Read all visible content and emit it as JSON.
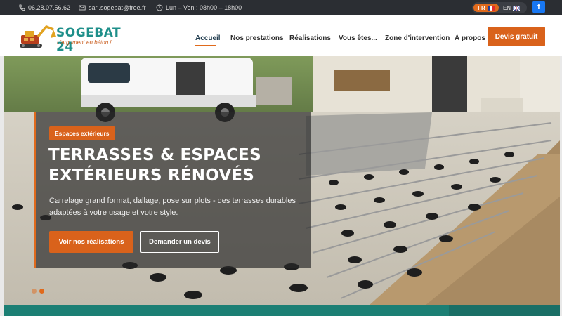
{
  "topbar": {
    "phone": "06.28.07.56.62",
    "email": "sarl.sogebat@free.fr",
    "hours": "Lun – Ven : 08h00 – 18h00",
    "lang_fr": "FR",
    "lang_en": "EN",
    "facebook": "f"
  },
  "header": {
    "logo_name": "SOGEBAT 24",
    "logo_tagline": "L'argument en béton !",
    "nav": [
      "Accueil",
      "Nos prestations",
      "Réalisations",
      "Vous êtes...",
      "Zone d'intervention",
      "À propos"
    ],
    "cta": "Devis gratuit"
  },
  "hero": {
    "badge": "Espaces extérieurs",
    "title_line1": "TERRASSES & ESPACES",
    "title_line2": "EXTÉRIEURS RÉNOVÉS",
    "description": "Carrelage grand format, dallage, pose sur plots - des terrasses durables adaptées à votre usage et votre style.",
    "primary_button": "Voir nos réalisations",
    "secondary_button": "Demander un devis"
  },
  "colors": {
    "accent": "#d9621b",
    "brand_teal": "#1e8f8a",
    "topbar": "#2b2e33"
  }
}
